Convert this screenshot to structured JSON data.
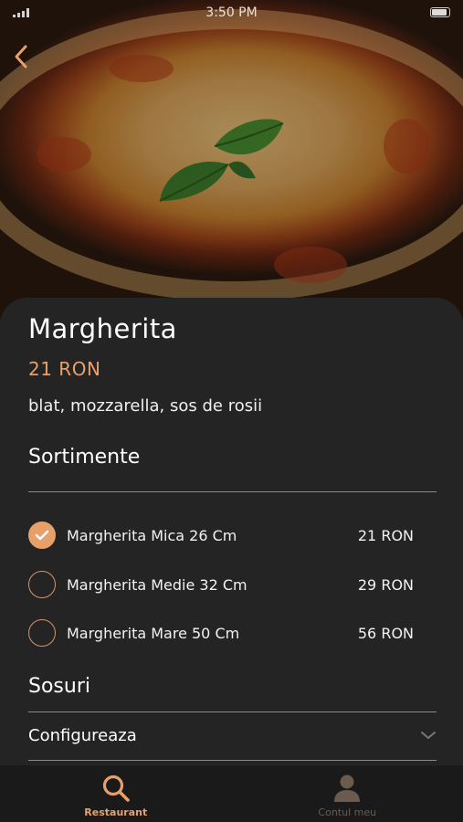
{
  "status_bar": {
    "time": "3:50 PM"
  },
  "product": {
    "name": "Margherita",
    "price": "21 RON",
    "description": "blat, mozzarella, sos de rosii"
  },
  "sortimente": {
    "title": "Sortimente",
    "options": [
      {
        "label": "Margherita Mica 26 Cm",
        "price": "21 RON",
        "selected": true
      },
      {
        "label": "Margherita Medie 32 Cm",
        "price": "29 RON",
        "selected": false
      },
      {
        "label": "Margherita Mare 50 Cm",
        "price": "56 RON",
        "selected": false
      }
    ]
  },
  "sosuri": {
    "title": "Sosuri",
    "dropdown_label": "Configureaza"
  },
  "tabbar": {
    "tabs": [
      {
        "label": "Restaurant",
        "icon": "search-icon",
        "active": true
      },
      {
        "label": "Contul meu",
        "icon": "user-icon",
        "active": false
      }
    ]
  },
  "colors": {
    "accent": "#e8a06a",
    "sheet_background": "#242424",
    "tabbar_background": "#1a1a1a",
    "inactive_tab": "#6b5a4e"
  }
}
